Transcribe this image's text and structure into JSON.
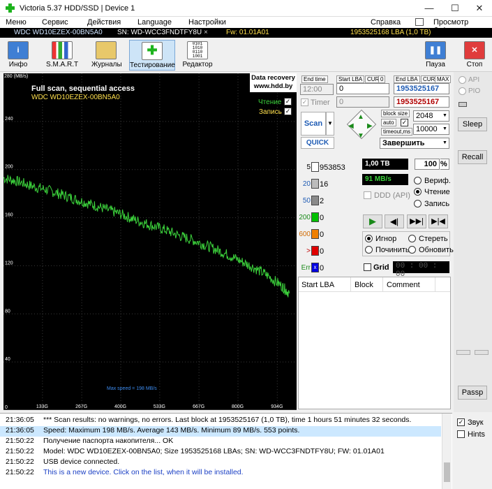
{
  "window": {
    "title": "Victoria 5.37 HDD/SSD | Device 1",
    "minimize": "—",
    "maximize": "☐",
    "close": "✕"
  },
  "menu": {
    "items": [
      "Меню",
      "Сервис",
      "Действия",
      "Language",
      "Настройки",
      "Справка"
    ],
    "clipboard": "Просмотр буфера"
  },
  "device": {
    "model": "WDC WD10EZEX-00BN5A0",
    "serial": "SN: WD-WCC3FNDTFY8U",
    "close": "×",
    "firmware": "Fw: 01.01A01",
    "capacity": "1953525168 LBA (1,0 TB)"
  },
  "toolbar": {
    "info": "Инфо",
    "smart": "S.M.A.R.T",
    "journals": "Журналы",
    "testing": "Тестирование",
    "editor": "Редактор",
    "pause": "Пауза",
    "stop": "Стоп"
  },
  "graph": {
    "yunit": "280 (MB/s)",
    "title": "Full scan, sequential access",
    "subtitle": "WDC WD10EZEX-00BN5A0",
    "read_label": "Чтение",
    "write_label": "Запись",
    "badge_line1": "Data recovery",
    "badge_line2": "www.hdd.by",
    "max_speed": "Max speed = 198 MB/s",
    "yticks": [
      "240",
      "200",
      "160",
      "120",
      "80",
      "40",
      "0"
    ],
    "xticks": [
      "133G",
      "267G",
      "400G",
      "533G",
      "667G",
      "800G",
      "934G"
    ]
  },
  "chart_data": {
    "type": "line",
    "title": "Full scan, sequential access",
    "ylabel": "(MB/s)",
    "ylim": [
      0,
      280
    ],
    "xlim": [
      0,
      1000
    ],
    "x_unit": "GB",
    "series": [
      {
        "name": "Чтение",
        "x": [
          0,
          50,
          100,
          150,
          200,
          250,
          300,
          350,
          400,
          450,
          500,
          550,
          600,
          650,
          700,
          750,
          800,
          850,
          900,
          950,
          975
        ],
        "y": [
          193,
          190,
          186,
          183,
          179,
          175,
          171,
          167,
          163,
          158,
          154,
          150,
          145,
          141,
          136,
          131,
          125,
          119,
          112,
          103,
          97
        ]
      }
    ]
  },
  "controls": {
    "end_time_label": "End time",
    "start_lba_label": "Start LBA",
    "end_lba_label": "End LBA",
    "cur": "CUR",
    "cur2": "CUR",
    "zero": "0",
    "max": "MAX",
    "time_value": "12:00",
    "start_lba": "0",
    "end_lba": "1953525167",
    "timer_label": "Timer",
    "timer_value": "0",
    "end_lba2": "1953525167",
    "scan": "Scan",
    "quick": "QUICK",
    "block_size_label": "block size",
    "auto_label": "auto",
    "timeout_label": "timeout,ms",
    "block_size": "2048",
    "timeout": "10000",
    "finish": "Завершить"
  },
  "blocks": [
    {
      "label": "5",
      "count": "953853",
      "color": "#ffffff"
    },
    {
      "label": "20",
      "count": "16",
      "color": "#bcbcbc"
    },
    {
      "label": "50",
      "count": "2",
      "color": "#8a8a8a"
    },
    {
      "label": "200",
      "count": "0",
      "color": "#00c000"
    },
    {
      "label": "600",
      "count": "0",
      "color": "#f08000"
    },
    {
      "label": ">",
      "count": "0",
      "color": "#e00000"
    },
    {
      "label": "Err",
      "count": "0",
      "color": "#0000e0"
    }
  ],
  "stats": {
    "size": "1,00 TB",
    "percent": "100",
    "pct_sign": "%",
    "speed": "91 MB/s",
    "ddd": "DDD (API)",
    "verify": "Вериф.",
    "read": "Чтение",
    "write": "Запись"
  },
  "actions": {
    "ignore": "Игнор",
    "erase": "Стереть",
    "repair": "Починить",
    "refresh": "Обновить",
    "grid": "Grid",
    "timer": "00 : 00 : 00"
  },
  "table": {
    "columns": [
      "Start LBA",
      "Block",
      "Comment"
    ]
  },
  "side": {
    "api": "API",
    "pio": "PIO",
    "sleep": "Sleep",
    "recall": "Recall",
    "passp": "Passp",
    "sound": "Звук",
    "hints": "Hints"
  },
  "log": [
    {
      "time": "21:36:05",
      "msg": "*** Scan results: no warnings, no errors. Last block at 1953525167 (1,0 TB), time 1 hours 51 minutes 32 seconds."
    },
    {
      "time": "21:36:05",
      "msg": "Speed: Maximum 198 MB/s. Average 143 MB/s. Minimum 89 MB/s. 553 points."
    },
    {
      "time": "21:50:22",
      "msg": "Получение паспорта накопителя... OK"
    },
    {
      "time": "21:50:22",
      "msg": "Model: WDC WD10EZEX-00BN5A0; Size 1953525168 LBAs; SN: WD-WCC3FNDTFY8U; FW: 01.01A01"
    },
    {
      "time": "21:50:22",
      "msg": "USB device connected."
    },
    {
      "time": "21:50:22",
      "msg": "This is a new device. Click on the list, when it will be installed."
    }
  ],
  "colors": {
    "graph_line": "#3cd23c",
    "accent_blue": "#1e5bb4",
    "log_blue": "#1a3fc4",
    "highlight": "#cce8ff"
  }
}
